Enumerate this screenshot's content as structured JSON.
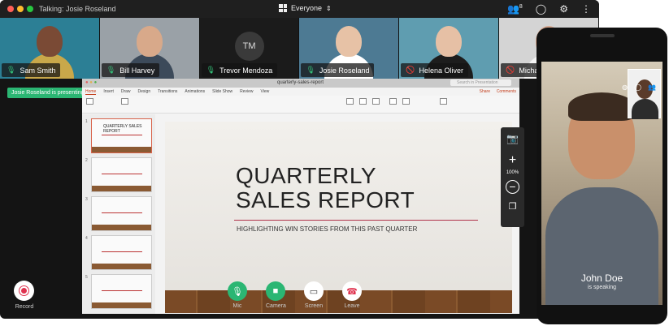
{
  "topbar": {
    "talking": "Talking: Josie Roseland",
    "room": "Everyone",
    "participants_count": "8"
  },
  "tiles": [
    {
      "name": "Sam Smith",
      "mic": "on",
      "bg": "#2c7f95",
      "skin": "#7a4a35",
      "shirt": "#c9a84a"
    },
    {
      "name": "Bill Harvey",
      "mic": "on",
      "bg": "#9aa1a7",
      "skin": "#d8a98a",
      "shirt": "#3c4a5a"
    },
    {
      "name": "Trevor Mendoza",
      "mic": "on",
      "initials": "TM",
      "bg": "#1b1b1b"
    },
    {
      "name": "Josie Roseland",
      "mic": "on",
      "bg": "#4d7a93",
      "skin": "#e7c2a6",
      "shirt": "#ffffff"
    },
    {
      "name": "Helena Oliver",
      "mic": "off",
      "bg": "#5f9db0",
      "skin": "#e6c0a5",
      "shirt": "#1d1d1d"
    },
    {
      "name": "Michael Higgins",
      "mic": "off",
      "bg": "#d4d4d4",
      "skin": "#d4a38a",
      "shirt": "#f2f2f2"
    }
  ],
  "presenting_badge": "Josie Roseland is presenting",
  "ppt": {
    "filename": "quarterly-sales-report",
    "search_placeholder": "Search in Presentation",
    "tabs": [
      "Home",
      "Insert",
      "Draw",
      "Design",
      "Transitions",
      "Animations",
      "Slide Show",
      "Review",
      "View"
    ],
    "share": "Share",
    "comments": "Comments",
    "slide_title_line1": "QUARTERLY",
    "slide_title_line2": "SALES REPORT",
    "slide_subtitle": "HIGHLIGHTING WIN STORIES FROM THIS PAST QUARTER",
    "thumb_title": "QUARTERLY SALES REPORT",
    "thumb_numbers": [
      "1",
      "2",
      "3",
      "4",
      "5"
    ]
  },
  "zoom": {
    "level": "100%"
  },
  "controls": {
    "mic": "Mic",
    "camera": "Camera",
    "screen": "Screen",
    "leave": "Leave",
    "record": "Record"
  },
  "colors": {
    "green": "#2bb673",
    "red": "#e0334f",
    "accent_ppt": "#c43e1c"
  },
  "phone": {
    "speaker_name": "John Doe",
    "speaker_status": "is speaking"
  }
}
